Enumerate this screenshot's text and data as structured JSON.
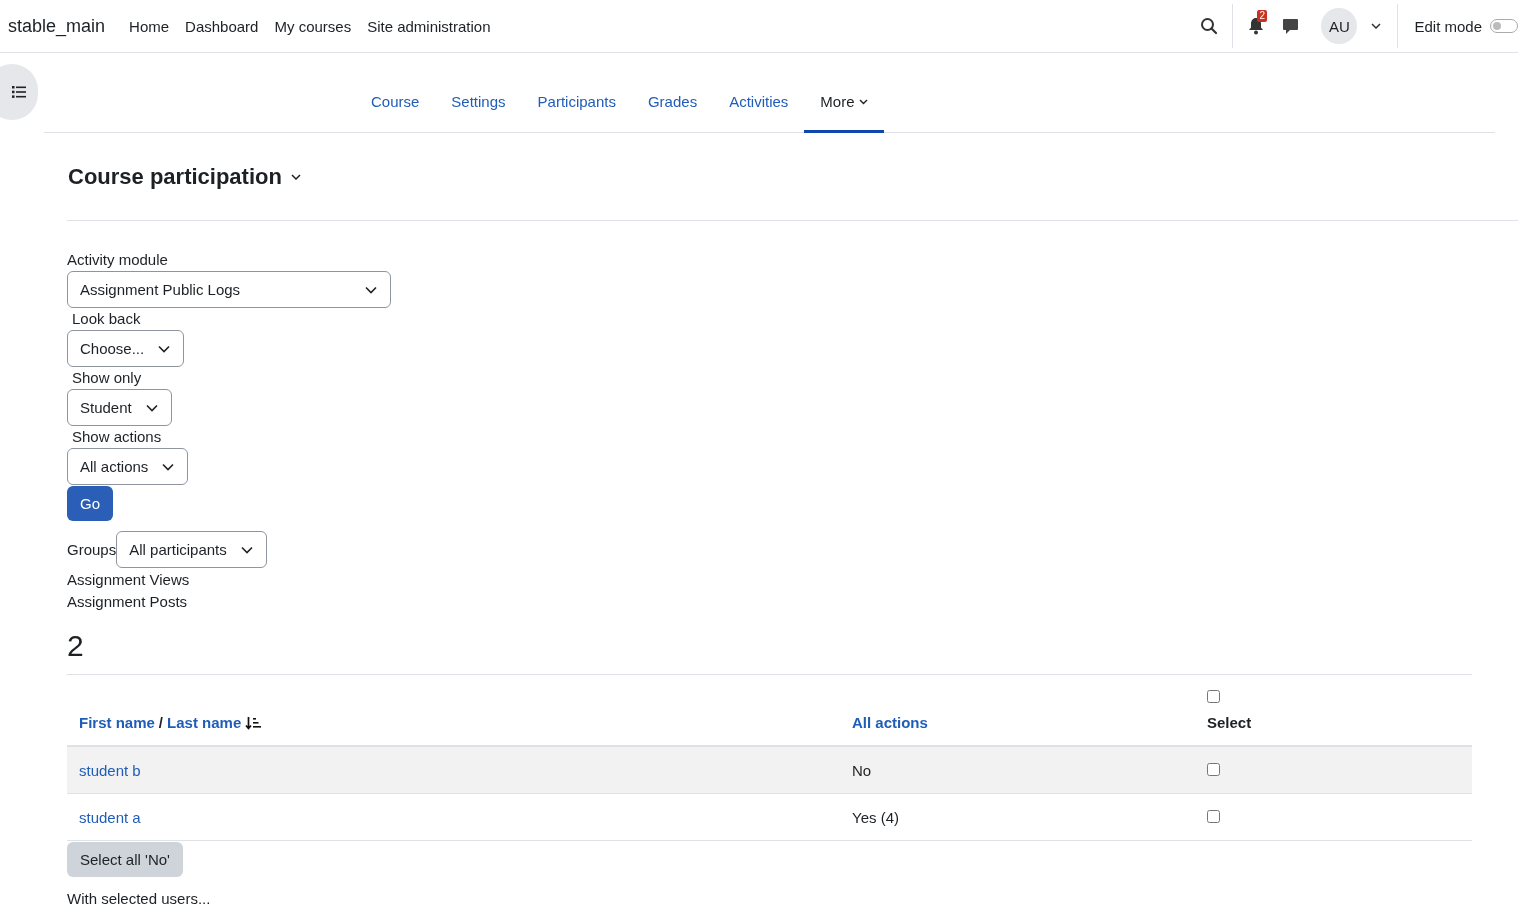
{
  "site_name": "stable_main",
  "nav": [
    {
      "label": "Home"
    },
    {
      "label": "Dashboard"
    },
    {
      "label": "My courses"
    },
    {
      "label": "Site administration"
    }
  ],
  "notifications_count": "2",
  "avatar": "AU",
  "edit_mode": {
    "label": "Edit mode",
    "on": false
  },
  "tabs": [
    {
      "label": "Course",
      "selected": false
    },
    {
      "label": "Settings",
      "selected": false
    },
    {
      "label": "Participants",
      "selected": false
    },
    {
      "label": "Grades",
      "selected": false
    },
    {
      "label": "Activities",
      "selected": false
    },
    {
      "label": "More",
      "selected": true
    }
  ],
  "page_title": "Course participation",
  "filters": [
    {
      "label": "Activity module",
      "value": "Assignment Public Logs"
    },
    {
      "label": "Look back",
      "value": "Choose..."
    },
    {
      "label": "Show only",
      "value": "Student"
    },
    {
      "label": "Show actions",
      "value": "All actions"
    }
  ],
  "go_button": "Go",
  "groups": {
    "label": "Groups",
    "value": "All participants"
  },
  "lines": [
    "Assignment Views",
    "Assignment Posts"
  ],
  "count": "2",
  "table": {
    "columns": [
      {
        "label": "First name"
      },
      {
        "label": "Last name"
      }
    ],
    "sep": "/",
    "actions_column": "All actions",
    "select_column": "Select",
    "select_all_checked": false,
    "rows": [
      {
        "name": "student b",
        "value": "No",
        "checked": false
      },
      {
        "name": "student a",
        "value": "Yes (4)",
        "checked": false
      }
    ]
  },
  "select_all_no_button": "Select all 'No'",
  "with_selected": "With selected users..."
}
